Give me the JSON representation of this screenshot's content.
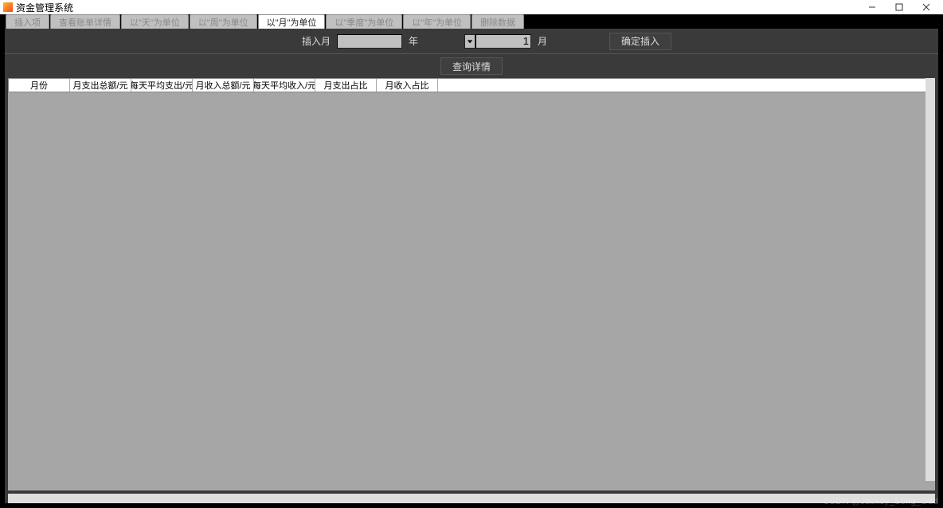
{
  "window": {
    "title": "资金管理系统",
    "dash": "–"
  },
  "tabs": [
    {
      "label": "插入项"
    },
    {
      "label": "查看账单详情"
    },
    {
      "label": "以\"天\"为单位"
    },
    {
      "label": "以\"周\"为单位"
    },
    {
      "label": "以\"月\"为单位"
    },
    {
      "label": "以\"季度\"为单位"
    },
    {
      "label": "以\"年\"为单位"
    },
    {
      "label": "删除数据"
    }
  ],
  "controls": {
    "insert_month_label": "插入月",
    "year_input": "",
    "year_suffix": "年",
    "month_input": "1",
    "month_suffix": "月",
    "confirm_btn": "确定插入",
    "query_btn": "查询详情"
  },
  "table": {
    "headers": [
      "月份",
      "月支出总额/元",
      "每天平均支出/元",
      "月收入总额/元",
      "每天平均收入/元",
      "月支出占比",
      "月收入占比"
    ]
  },
  "watermark": "CSDN @Jackey_Song_Odd"
}
